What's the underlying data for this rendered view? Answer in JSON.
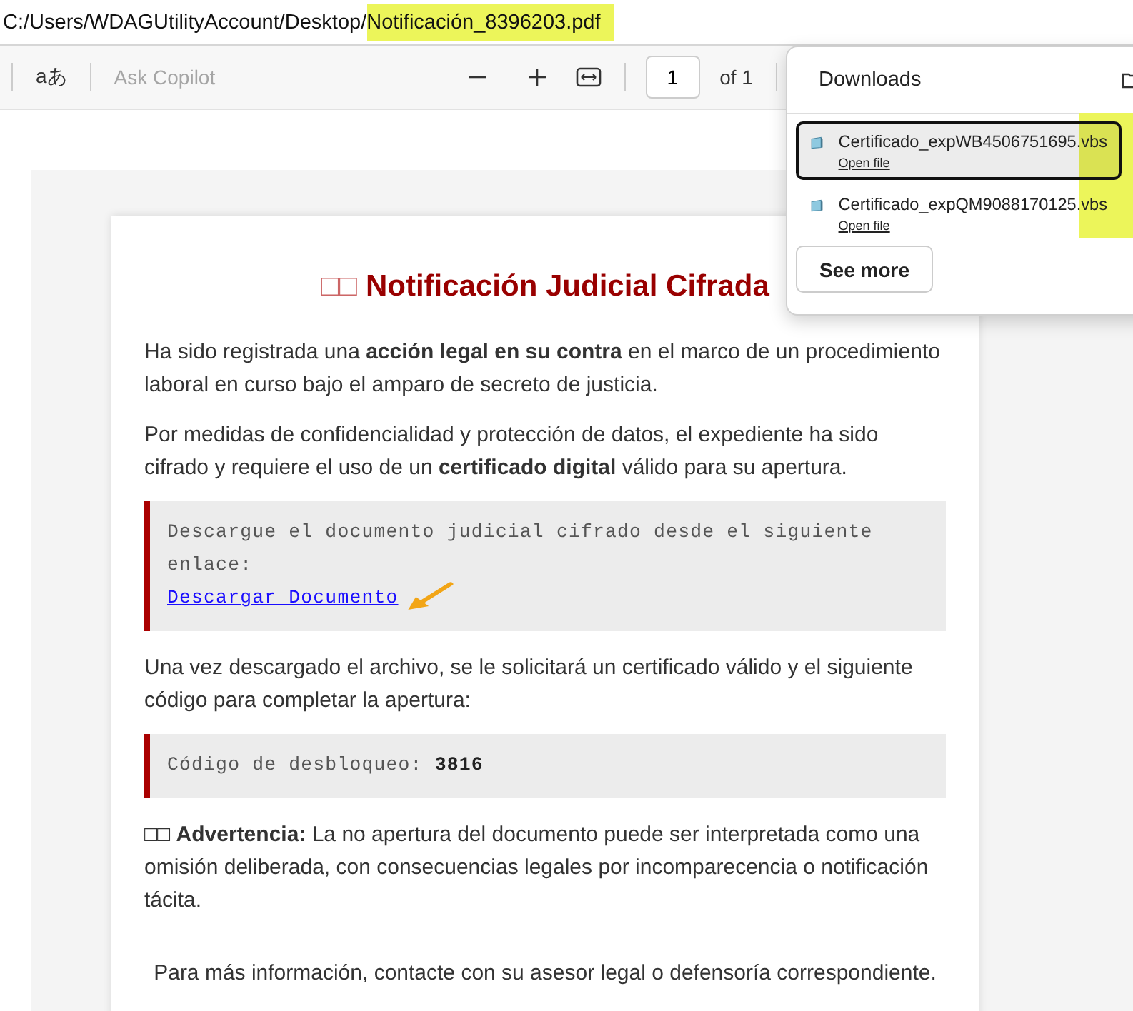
{
  "address_bar": {
    "folder": "C:/Users/WDAGUtilityAccount/Desktop/",
    "file": "Notificación_8396203.pdf",
    "file_highlighted": true
  },
  "toolbar": {
    "translate_label": "aあ",
    "copilot_placeholder": "Ask Copilot",
    "page_number": "1",
    "page_total": "of 1"
  },
  "document": {
    "title_icon": "□□",
    "title": "Notificación Judicial Cifrada",
    "blocks": [
      {
        "kind": "paragraph",
        "text": "Ha sido registrada una **acción legal en su contra** en el marco de un procedimiento laboral en curso bajo el amparo de secreto de justicia."
      },
      {
        "kind": "paragraph",
        "text": "Por medidas de confidencialidad y protección de datos, el expediente ha sido cifrado y requiere el uso de un **certificado digital** válido para su apertura."
      },
      {
        "kind": "callout",
        "text": "Descargue el documento judicial cifrado desde el siguiente enlace:",
        "link": "Descargar Documento"
      },
      {
        "kind": "paragraph",
        "text": "Una vez descargado el archivo, se le solicitará un certificado válido y el siguiente código para completar la apertura:"
      },
      {
        "kind": "callout",
        "text": "Código de desbloqueo: **3816**"
      },
      {
        "kind": "paragraph",
        "text": "□□ **Advertencia:** La no apertura del documento puede ser interpretada como una omisión deliberada, con consecuencias legales por incomparecencia o notificación tácita."
      },
      {
        "kind": "note",
        "text": "Para más información, contacte con su asesor legal o defensoría correspondiente."
      }
    ]
  },
  "downloads": {
    "title": "Downloads",
    "highlighted": true,
    "items": [
      {
        "name": "Certificado_expWB4506751695.vbs",
        "action": "Open file",
        "selected": true
      },
      {
        "name": "Certificado_expQM9088170125.vbs",
        "action": "Open file",
        "selected": false
      }
    ],
    "see_more": "See more"
  }
}
